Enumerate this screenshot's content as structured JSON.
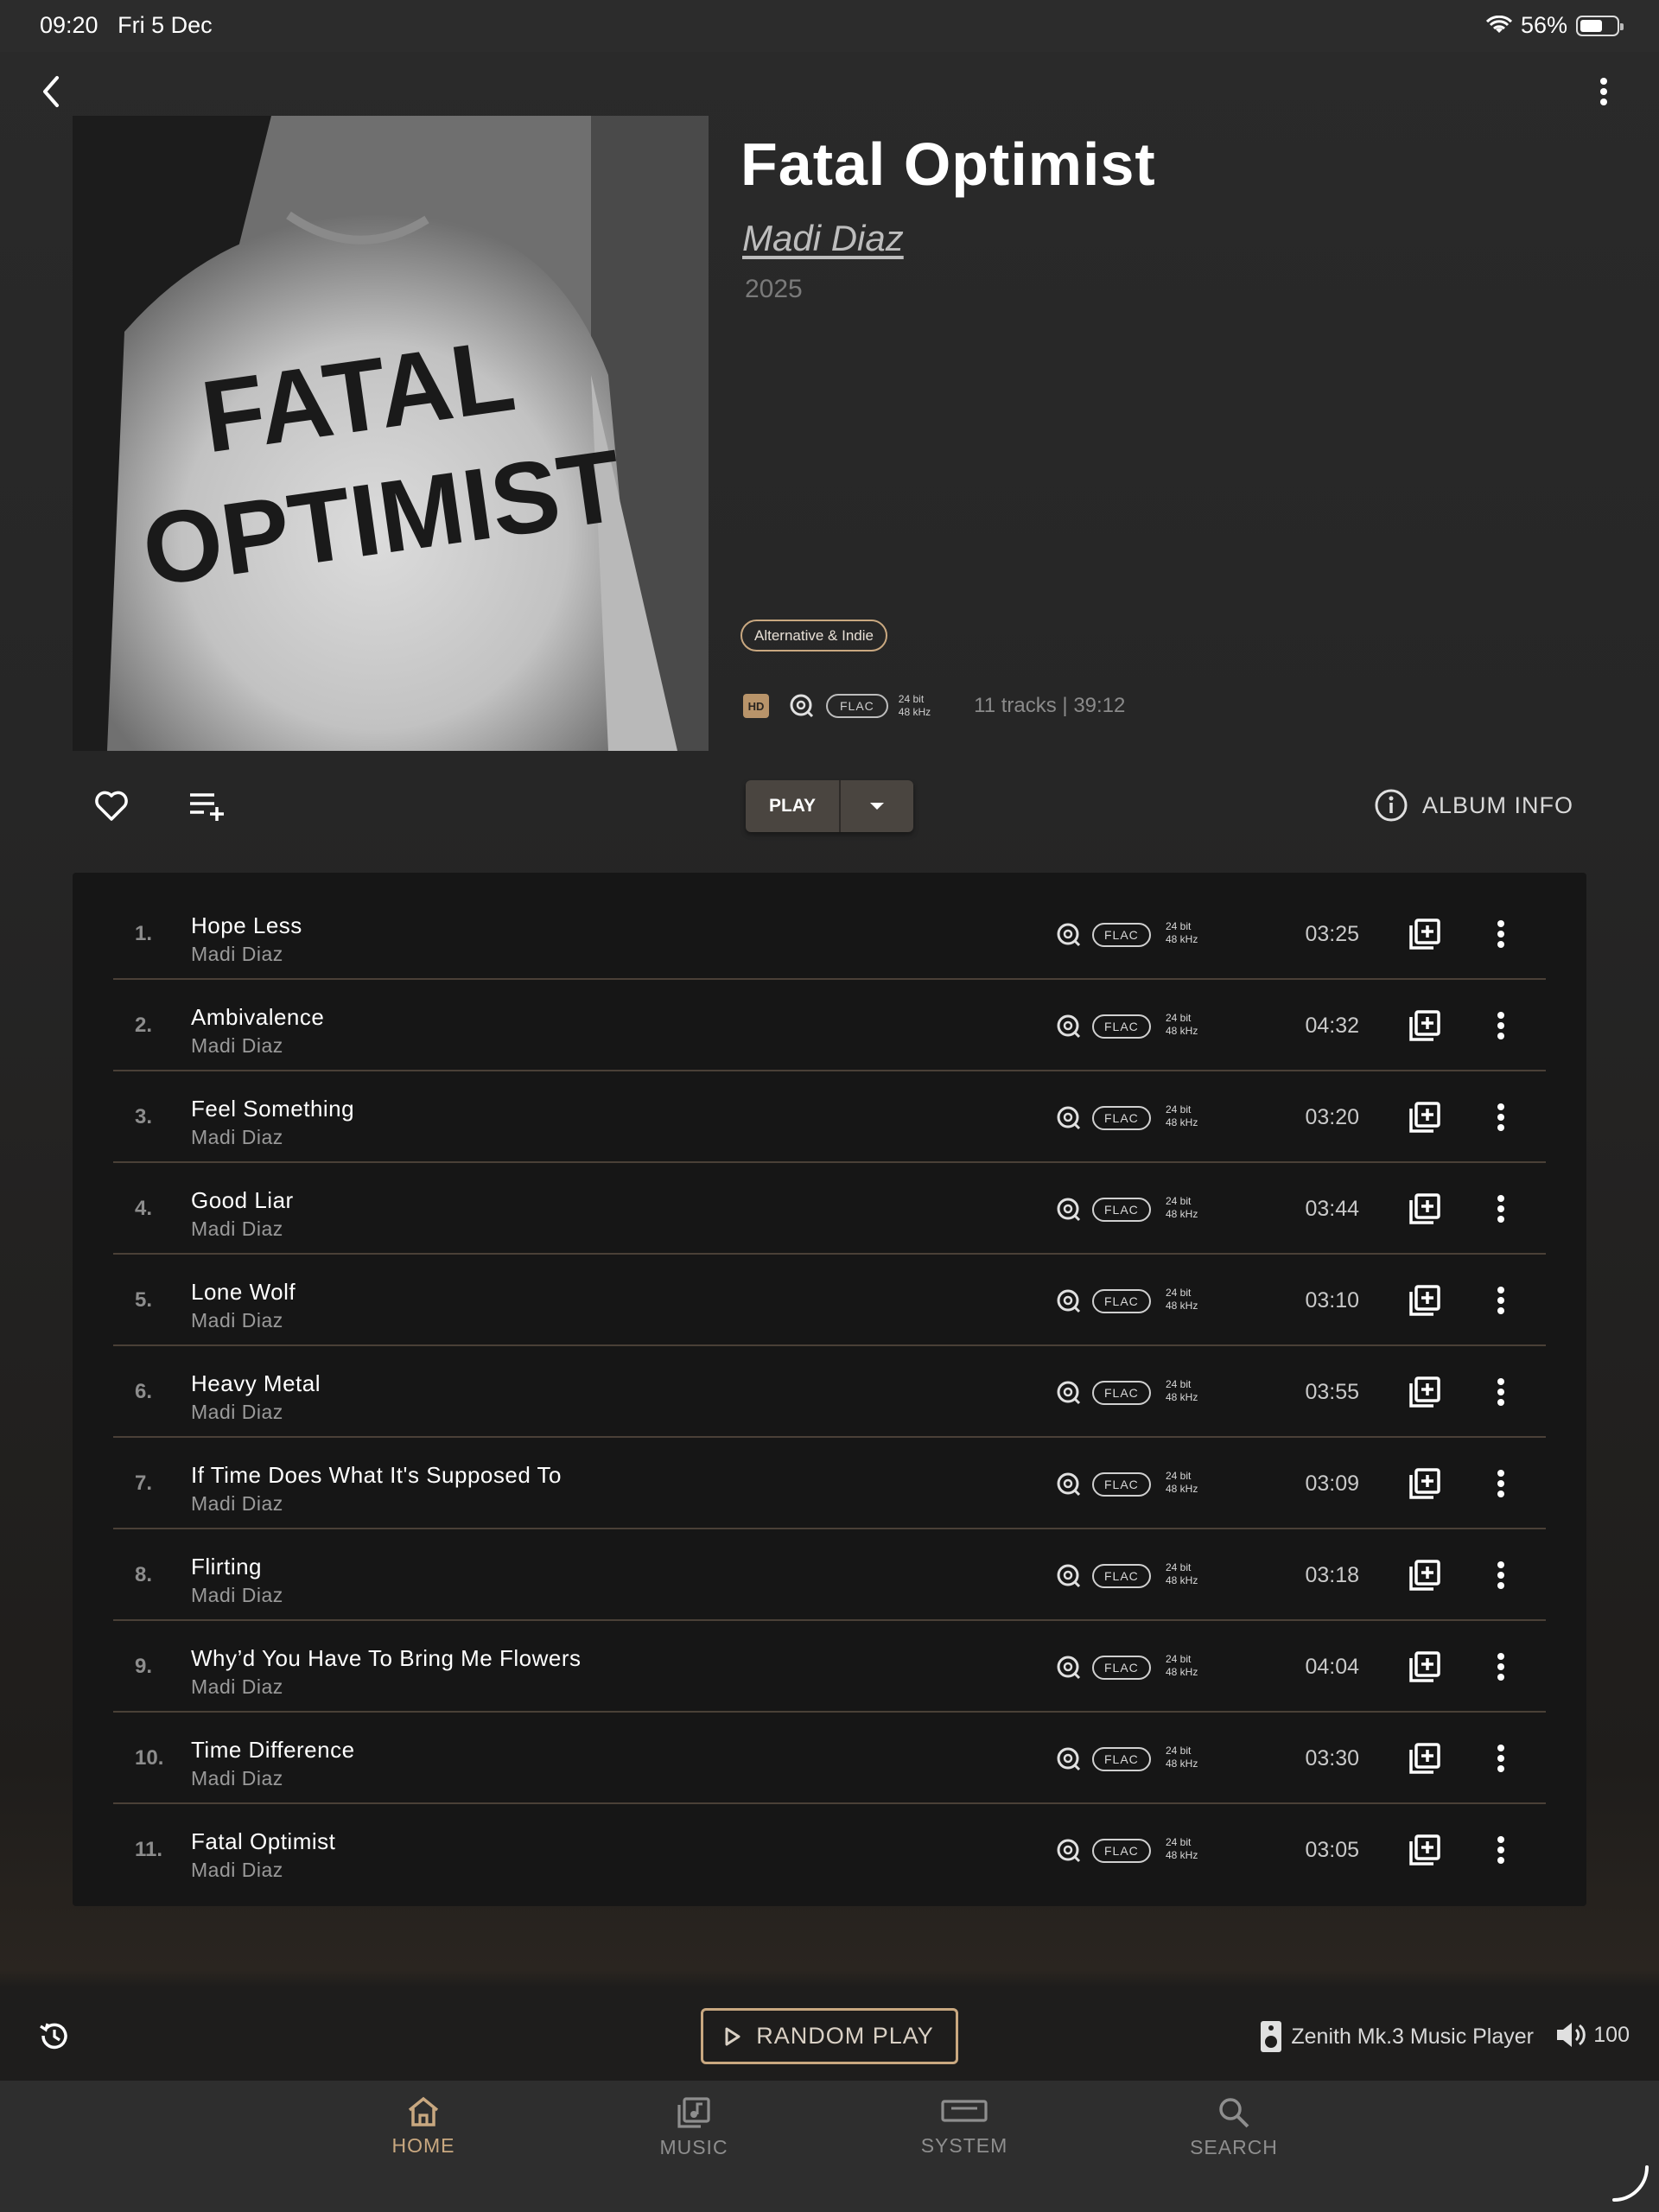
{
  "status_bar": {
    "time": "09:20",
    "date": "Fri 5 Dec",
    "battery": "56%",
    "battery_level": 0.56
  },
  "album": {
    "title": "Fatal Optimist",
    "artist": "Madi Diaz",
    "year": "2025",
    "genre": "Alternative & Indie",
    "hd_badge": "HD",
    "format": "FLAC",
    "bit_depth": "24 bit",
    "sample_rate": "48 kHz",
    "summary": "11 tracks | 39:12",
    "cover_text_line1": "FATAL",
    "cover_text_line2": "OPTIMIST"
  },
  "controls": {
    "play_label": "PLAY",
    "album_info_label": "ALBUM INFO"
  },
  "tracks": [
    {
      "num": "1.",
      "title": "Hope Less",
      "artist": "Madi Diaz",
      "format": "FLAC",
      "bits": "24 bit",
      "rate": "48 kHz",
      "duration": "03:25"
    },
    {
      "num": "2.",
      "title": "Ambivalence",
      "artist": "Madi Diaz",
      "format": "FLAC",
      "bits": "24 bit",
      "rate": "48 kHz",
      "duration": "04:32"
    },
    {
      "num": "3.",
      "title": "Feel Something",
      "artist": "Madi Diaz",
      "format": "FLAC",
      "bits": "24 bit",
      "rate": "48 kHz",
      "duration": "03:20"
    },
    {
      "num": "4.",
      "title": "Good Liar",
      "artist": "Madi Diaz",
      "format": "FLAC",
      "bits": "24 bit",
      "rate": "48 kHz",
      "duration": "03:44"
    },
    {
      "num": "5.",
      "title": "Lone Wolf",
      "artist": "Madi Diaz",
      "format": "FLAC",
      "bits": "24 bit",
      "rate": "48 kHz",
      "duration": "03:10"
    },
    {
      "num": "6.",
      "title": "Heavy Metal",
      "artist": "Madi Diaz",
      "format": "FLAC",
      "bits": "24 bit",
      "rate": "48 kHz",
      "duration": "03:55"
    },
    {
      "num": "7.",
      "title": "If Time Does What It's Supposed To",
      "artist": "Madi Diaz",
      "format": "FLAC",
      "bits": "24 bit",
      "rate": "48 kHz",
      "duration": "03:09"
    },
    {
      "num": "8.",
      "title": "Flirting",
      "artist": "Madi Diaz",
      "format": "FLAC",
      "bits": "24 bit",
      "rate": "48 kHz",
      "duration": "03:18"
    },
    {
      "num": "9.",
      "title": "Why’d You Have To Bring Me Flowers",
      "artist": "Madi Diaz",
      "format": "FLAC",
      "bits": "24 bit",
      "rate": "48 kHz",
      "duration": "04:04"
    },
    {
      "num": "10.",
      "title": "Time Difference",
      "artist": "Madi Diaz",
      "format": "FLAC",
      "bits": "24 bit",
      "rate": "48 kHz",
      "duration": "03:30"
    },
    {
      "num": "11.",
      "title": "Fatal Optimist",
      "artist": "Madi Diaz",
      "format": "FLAC",
      "bits": "24 bit",
      "rate": "48 kHz",
      "duration": "03:05"
    }
  ],
  "player": {
    "random_play_label": "RANDOM PLAY",
    "device": "Zenith Mk.3 Music Player",
    "volume": "100"
  },
  "tabs": [
    {
      "label": "HOME",
      "icon": "home-icon",
      "active": true
    },
    {
      "label": "MUSIC",
      "icon": "music-library-icon",
      "active": false
    },
    {
      "label": "SYSTEM",
      "icon": "system-device-icon",
      "active": false
    },
    {
      "label": "SEARCH",
      "icon": "search-icon",
      "active": false
    }
  ],
  "colors": {
    "accent": "#c9a880",
    "background": "#262626",
    "tracklist_bg": "#161616",
    "divider": "#4a4037"
  }
}
